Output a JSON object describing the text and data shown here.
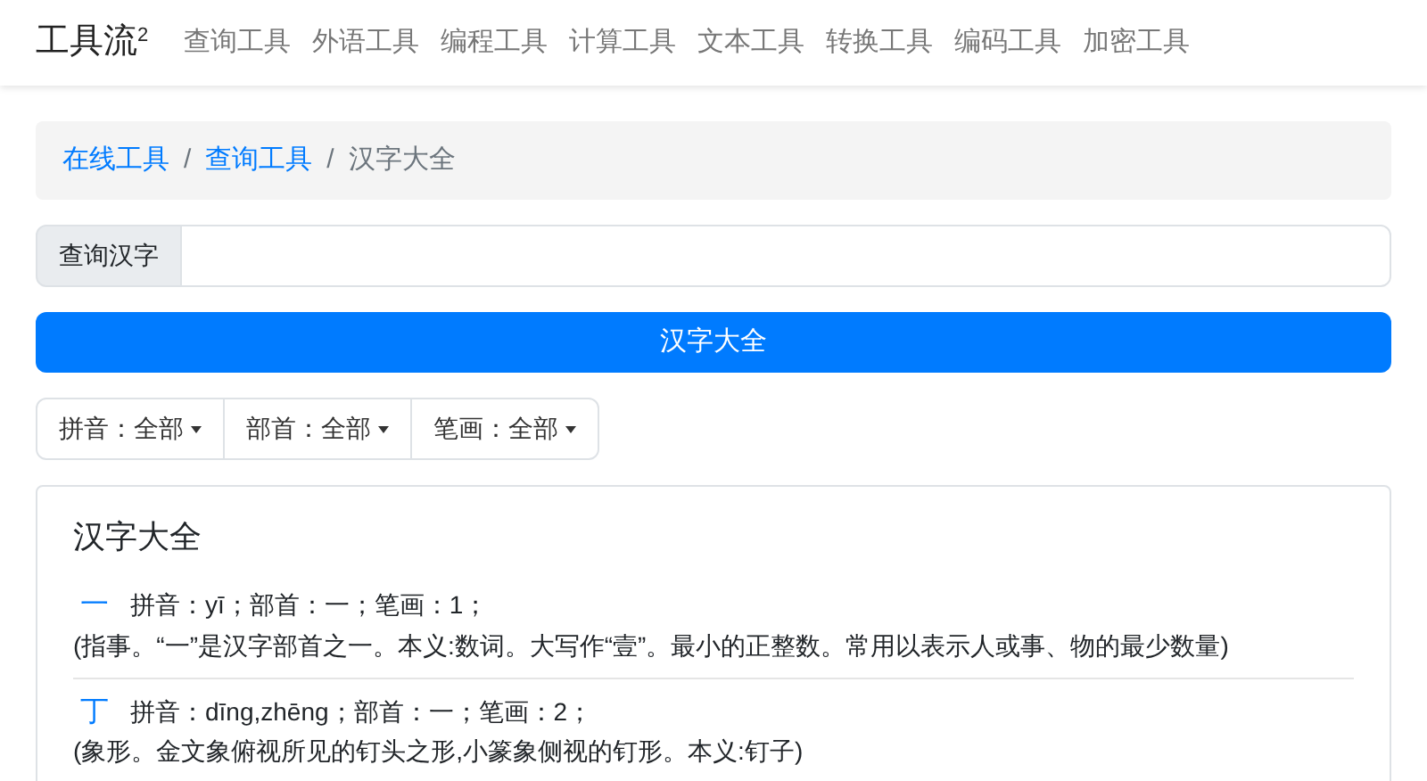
{
  "brand": {
    "name": "工具流",
    "sup": "2"
  },
  "nav_items": [
    "查询工具",
    "外语工具",
    "编程工具",
    "计算工具",
    "文本工具",
    "转换工具",
    "编码工具",
    "加密工具"
  ],
  "breadcrumb": [
    {
      "label": "在线工具",
      "link": true
    },
    {
      "separator": "/",
      "label": "查询工具",
      "link": true
    },
    {
      "separator": "/",
      "label": "汉字大全",
      "link": false
    }
  ],
  "search": {
    "label": "查询汉字"
  },
  "submit_button": "汉字大全",
  "filters": [
    {
      "label": "拼音：全部"
    },
    {
      "label": "部首：全部"
    },
    {
      "label": "笔画：全部"
    }
  ],
  "results": {
    "title": "汉字大全",
    "items": [
      {
        "char": "一",
        "info": "拼音：yī；部首：一；笔画：1；",
        "definition": "(指事。“一”是汉字部首之一。本义:数词。大写作“壹”。最小的正整数。常用以表示人或事、物的最少数量)"
      },
      {
        "char": "丁",
        "info": "拼音：dīng,zhēng；部首：一；笔画：2；",
        "definition": "(象形。金文象俯视所见的钉头之形,小篆象侧视的钉形。本义:钉子)"
      }
    ]
  }
}
